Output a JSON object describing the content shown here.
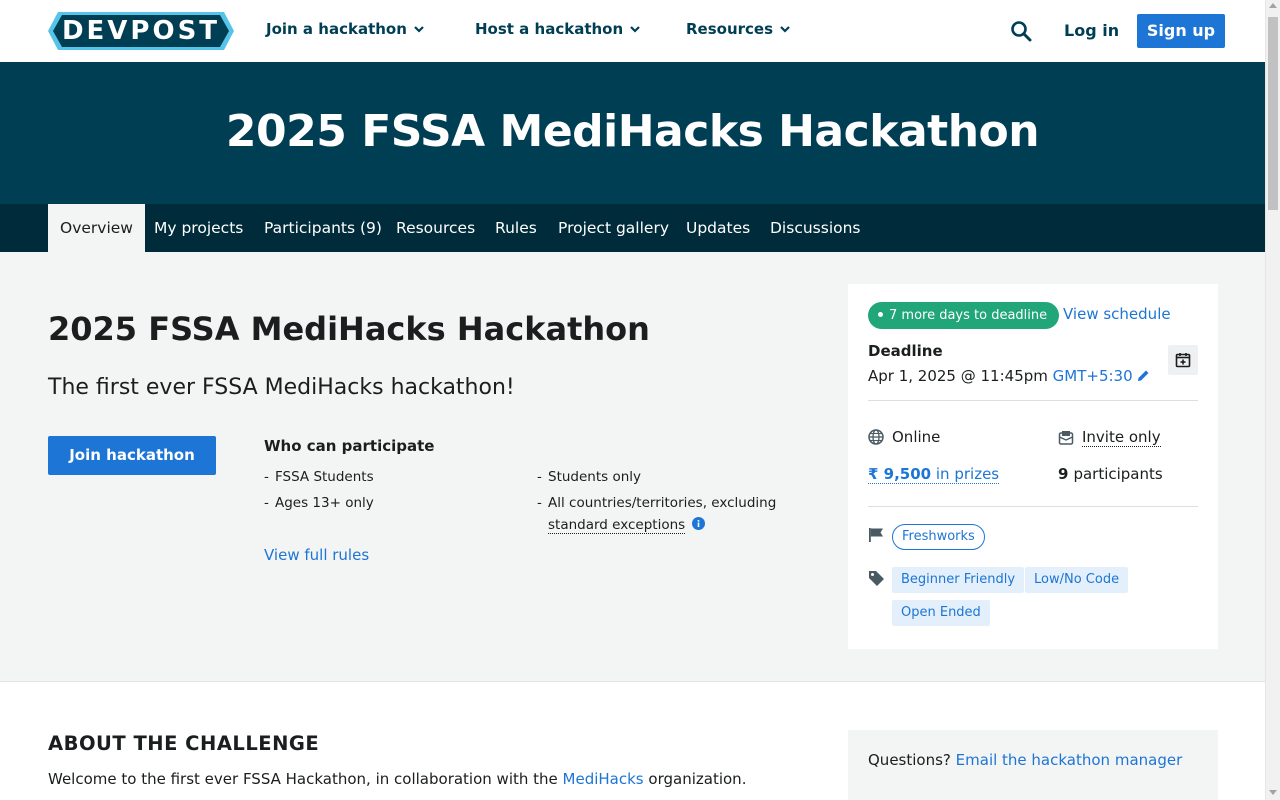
{
  "nav": {
    "logo": "DEVPOST",
    "menus": [
      "Join a hackathon",
      "Host a hackathon",
      "Resources"
    ],
    "login": "Log in",
    "signup": "Sign up"
  },
  "banner": {
    "title": "2025 FSSA MediHacks Hackathon"
  },
  "tabs": [
    "Overview",
    "My projects",
    "Participants (9)",
    "Resources",
    "Rules",
    "Project gallery",
    "Updates",
    "Discussions"
  ],
  "main": {
    "title": "2025 FSSA MediHacks Hackathon",
    "tagline": "The first ever FSSA MediHacks hackathon!",
    "join_button": "Join hackathon",
    "who_title": "Who can participate",
    "eligibility": {
      "dash": "-",
      "col1": [
        "FSSA Students",
        "Ages 13+ only"
      ],
      "col2_1": "Students only",
      "col2_2": "All countries/territories, excluding",
      "col2_2b": "standard exceptions"
    },
    "view_rules": "View full rules"
  },
  "sidebar": {
    "deadline_pill": "7 more days to deadline",
    "view_schedule": "View schedule",
    "deadline_label": "Deadline",
    "deadline_date": "Apr 1, 2025 @ 11:45pm",
    "timezone": "GMT+5:30",
    "location": "Online",
    "access": "Invite only",
    "prize_amount": "₹ 9,500",
    "prize_suffix": "in prizes",
    "participants_count": "9",
    "participants_label": "participants",
    "host": "Freshworks",
    "themes": [
      "Beginner Friendly",
      "Low/No Code",
      "Open Ended"
    ]
  },
  "about": {
    "heading": "ABOUT THE CHALLENGE",
    "intro_pre": "Welcome to the first ever FSSA Hackathon, in collaboration with the",
    "intro_link": "MediHacks",
    "intro_post": "organization.",
    "questions_pre": "Questions?",
    "questions_link": "Email the hackathon manager"
  },
  "colors": {
    "brand_dark": "#003e54",
    "tabs_bg": "#002b3a",
    "primary": "#1d75d5",
    "success": "#21a67a"
  }
}
